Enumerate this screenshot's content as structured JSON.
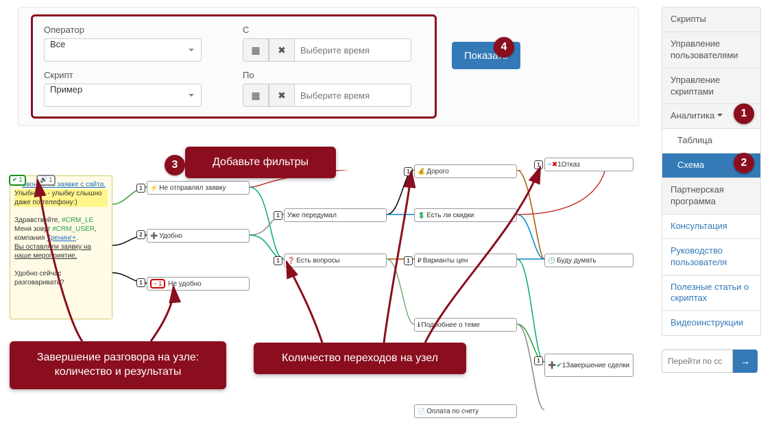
{
  "filters": {
    "operator_label": "Оператор",
    "operator_value": "Все",
    "script_label": "Скрипт",
    "script_value": "Пример",
    "from_label": "С",
    "to_label": "По",
    "time_placeholder": "Выберите время",
    "show_btn": "Показать"
  },
  "callouts": {
    "filters": "Добавьте фильтры",
    "transitions": "Количество переходов на узел",
    "completion": "Завершение разговора на узле: количество и результаты"
  },
  "badges": {
    "b1": "1",
    "b2": "2",
    "b3": "3",
    "b4": "4"
  },
  "sidebar": {
    "scripts": "Скрипты",
    "users": "Управление пользователями",
    "scriptmgmt": "Управление скриптами",
    "analytics": "Аналитика",
    "table": "Таблица",
    "scheme": "Схема",
    "partner": "Партнерская программа",
    "consult": "Консультация",
    "guide": "Руководство пользователя",
    "articles": "Полезные статьи о скриптах",
    "videos": "Видеоинструкции",
    "goto_placeholder": "Перейти по сс",
    "goto_arrow": "→"
  },
  "start_node": {
    "sound_count": "1",
    "check_count": "1",
    "link_text": "Звоним по заявке с сайта.",
    "smile": "Улыбнись - улыбку слышно даже по телефону:)",
    "greeting1": "Здравствуйте, ",
    "crm1": "#CRM_LE",
    "greeting2": "Меня зовут ",
    "crm2": "#CRM_USER",
    "company": ", компания ",
    "company_link": "Тренинг+",
    "ordered": "Вы оставляли заявку на наше мероприятие.",
    "convenient": "Удобно сейчас разговаривать?"
  },
  "nodes": {
    "n1": "Не отправлял заявку",
    "n2": "Удобно",
    "n3": "Не удобно",
    "n4": "Уже передумал",
    "n5": "Есть вопросы",
    "n6": "Дорого",
    "n7": "Есть ли скидки",
    "n8": "Варианты цен",
    "n9": "Подробнее о теме",
    "n10": "Отказ",
    "n10_count": "1",
    "n11": "Буду думать",
    "n12": "Завершение сделки",
    "n12_count": "1",
    "n13": "Оплата по счету",
    "minus": "1"
  },
  "link_counts": {
    "l1": "1",
    "l2": "2",
    "l3": "1",
    "l4": "1",
    "l5": "1",
    "l6": "1",
    "l7": "1",
    "l8": "1",
    "l9": "1"
  }
}
